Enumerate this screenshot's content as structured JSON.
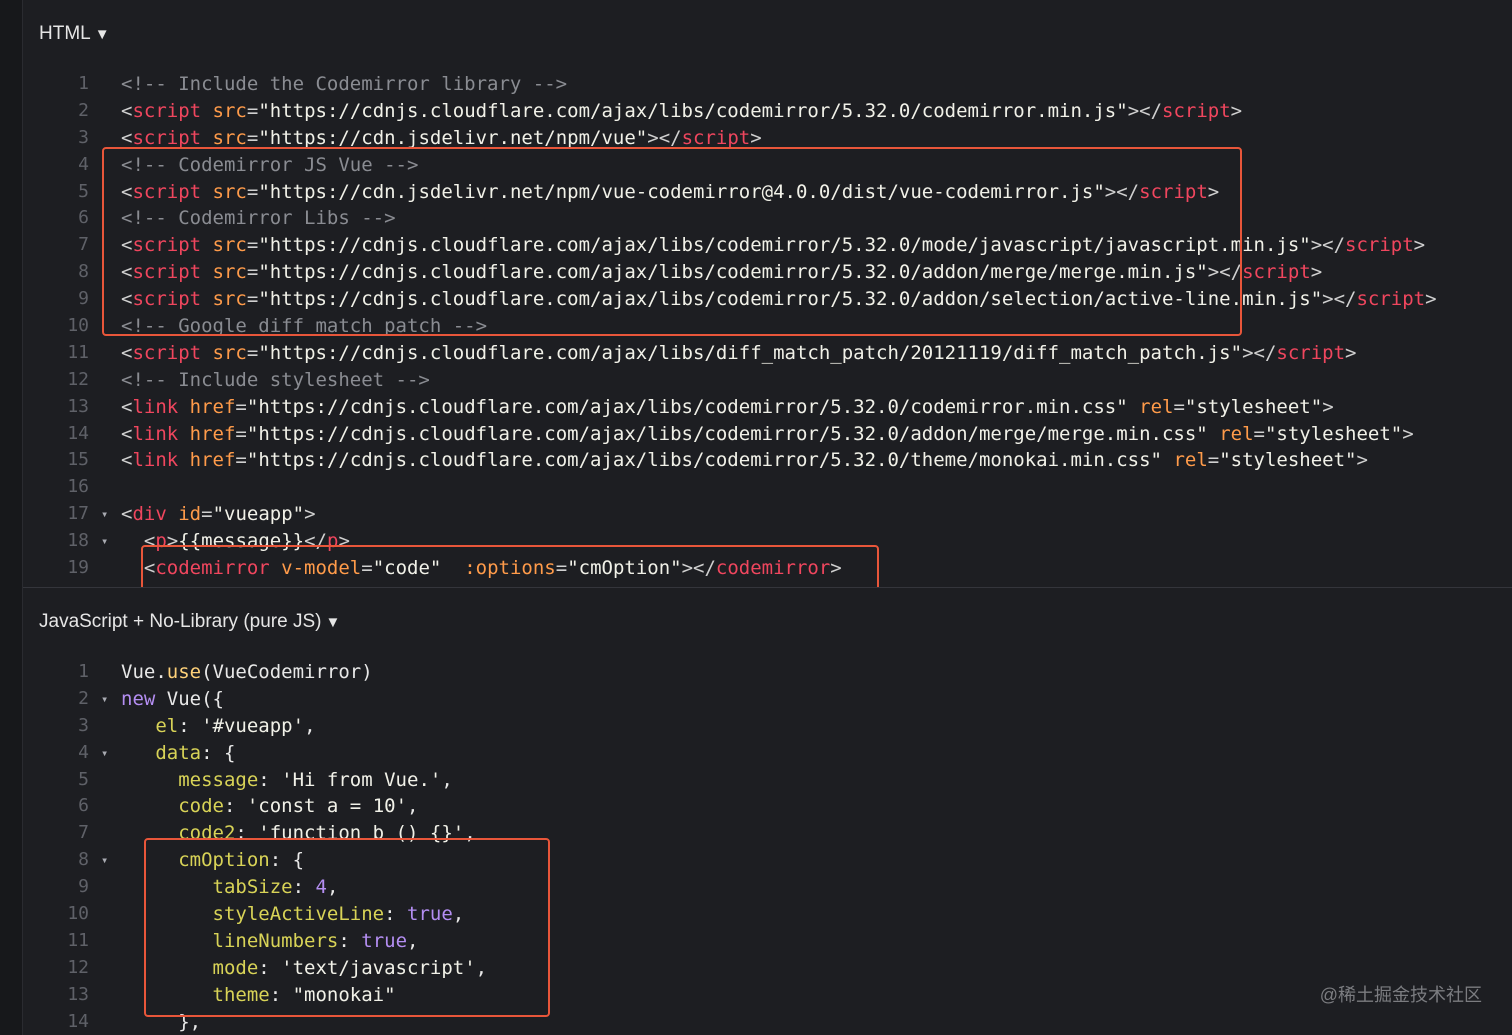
{
  "html_pane": {
    "header": "HTML",
    "lines": [
      {
        "n": "1",
        "fold": "",
        "t": [
          [
            "comment",
            "<!-- Include the Codemirror library -->"
          ]
        ]
      },
      {
        "n": "2",
        "fold": "",
        "t": [
          [
            "punct",
            "<"
          ],
          [
            "tag",
            "script"
          ],
          [
            "attr",
            " src"
          ],
          [
            "punct",
            "="
          ],
          [
            "str",
            "\"https://cdnjs.cloudflare.com/ajax/libs/codemirror/5.32.0/codemirror.min.js\""
          ],
          [
            "punct",
            "></"
          ],
          [
            "tag",
            "script"
          ],
          [
            "punct",
            ">"
          ]
        ]
      },
      {
        "n": "3",
        "fold": "",
        "t": [
          [
            "punct",
            "<"
          ],
          [
            "tag",
            "script"
          ],
          [
            "attr",
            " src"
          ],
          [
            "punct",
            "="
          ],
          [
            "str",
            "\"https://cdn.jsdelivr.net/npm/vue\""
          ],
          [
            "punct",
            "></"
          ],
          [
            "tag",
            "script"
          ],
          [
            "punct",
            ">"
          ]
        ]
      },
      {
        "n": "4",
        "fold": "",
        "t": [
          [
            "comment",
            "<!-- Codemirror JS Vue -->"
          ]
        ]
      },
      {
        "n": "5",
        "fold": "",
        "t": [
          [
            "punct",
            "<"
          ],
          [
            "tag",
            "script"
          ],
          [
            "attr",
            " src"
          ],
          [
            "punct",
            "="
          ],
          [
            "str",
            "\"https://cdn.jsdelivr.net/npm/vue-codemirror@4.0.0/dist/vue-codemirror.js\""
          ],
          [
            "punct",
            "></"
          ],
          [
            "tag",
            "script"
          ],
          [
            "punct",
            ">"
          ]
        ]
      },
      {
        "n": "6",
        "fold": "",
        "t": [
          [
            "comment",
            "<!-- Codemirror Libs -->"
          ]
        ]
      },
      {
        "n": "7",
        "fold": "",
        "t": [
          [
            "punct",
            "<"
          ],
          [
            "tag",
            "script"
          ],
          [
            "attr",
            " src"
          ],
          [
            "punct",
            "="
          ],
          [
            "str",
            "\"https://cdnjs.cloudflare.com/ajax/libs/codemirror/5.32.0/mode/javascript/javascript.min.js\""
          ],
          [
            "punct",
            "></"
          ],
          [
            "tag",
            "script"
          ],
          [
            "punct",
            ">"
          ]
        ]
      },
      {
        "n": "8",
        "fold": "",
        "t": [
          [
            "punct",
            "<"
          ],
          [
            "tag",
            "script"
          ],
          [
            "attr",
            " src"
          ],
          [
            "punct",
            "="
          ],
          [
            "str",
            "\"https://cdnjs.cloudflare.com/ajax/libs/codemirror/5.32.0/addon/merge/merge.min.js\""
          ],
          [
            "punct",
            "></"
          ],
          [
            "tag",
            "script"
          ],
          [
            "punct",
            ">"
          ]
        ]
      },
      {
        "n": "9",
        "fold": "",
        "t": [
          [
            "punct",
            "<"
          ],
          [
            "tag",
            "script"
          ],
          [
            "attr",
            " src"
          ],
          [
            "punct",
            "="
          ],
          [
            "str",
            "\"https://cdnjs.cloudflare.com/ajax/libs/codemirror/5.32.0/addon/selection/active-line.min.js\""
          ],
          [
            "punct",
            "></"
          ],
          [
            "tag",
            "script"
          ],
          [
            "punct",
            ">"
          ]
        ]
      },
      {
        "n": "10",
        "fold": "",
        "t": [
          [
            "comment",
            "<!-- Google diff match patch -->"
          ]
        ]
      },
      {
        "n": "11",
        "fold": "",
        "t": [
          [
            "punct",
            "<"
          ],
          [
            "tag",
            "script"
          ],
          [
            "attr",
            " src"
          ],
          [
            "punct",
            "="
          ],
          [
            "str",
            "\"https://cdnjs.cloudflare.com/ajax/libs/diff_match_patch/20121119/diff_match_patch.js\""
          ],
          [
            "punct",
            "></"
          ],
          [
            "tag",
            "script"
          ],
          [
            "punct",
            ">"
          ]
        ]
      },
      {
        "n": "12",
        "fold": "",
        "t": [
          [
            "comment",
            "<!-- Include stylesheet -->"
          ]
        ]
      },
      {
        "n": "13",
        "fold": "",
        "t": [
          [
            "punct",
            "<"
          ],
          [
            "tag",
            "link"
          ],
          [
            "attr",
            " href"
          ],
          [
            "punct",
            "="
          ],
          [
            "str",
            "\"https://cdnjs.cloudflare.com/ajax/libs/codemirror/5.32.0/codemirror.min.css\""
          ],
          [
            "attr",
            " rel"
          ],
          [
            "punct",
            "="
          ],
          [
            "str",
            "\"stylesheet\""
          ],
          [
            "punct",
            ">"
          ]
        ]
      },
      {
        "n": "14",
        "fold": "",
        "t": [
          [
            "punct",
            "<"
          ],
          [
            "tag",
            "link"
          ],
          [
            "attr",
            " href"
          ],
          [
            "punct",
            "="
          ],
          [
            "str",
            "\"https://cdnjs.cloudflare.com/ajax/libs/codemirror/5.32.0/addon/merge/merge.min.css\""
          ],
          [
            "attr",
            " rel"
          ],
          [
            "punct",
            "="
          ],
          [
            "str",
            "\"stylesheet\""
          ],
          [
            "punct",
            ">"
          ]
        ]
      },
      {
        "n": "15",
        "fold": "",
        "t": [
          [
            "punct",
            "<"
          ],
          [
            "tag",
            "link"
          ],
          [
            "attr",
            " href"
          ],
          [
            "punct",
            "="
          ],
          [
            "str",
            "\"https://cdnjs.cloudflare.com/ajax/libs/codemirror/5.32.0/theme/monokai.min.css\""
          ],
          [
            "attr",
            " rel"
          ],
          [
            "punct",
            "="
          ],
          [
            "str",
            "\"stylesheet\""
          ],
          [
            "punct",
            ">"
          ]
        ]
      },
      {
        "n": "16",
        "fold": "",
        "t": []
      },
      {
        "n": "17",
        "fold": "▾",
        "t": [
          [
            "punct",
            "<"
          ],
          [
            "tag",
            "div"
          ],
          [
            "attr",
            " id"
          ],
          [
            "punct",
            "="
          ],
          [
            "str",
            "\"vueapp\""
          ],
          [
            "punct",
            ">"
          ]
        ]
      },
      {
        "n": "18",
        "fold": "▾",
        "t": [
          [
            "plain",
            "  "
          ],
          [
            "punct",
            "<"
          ],
          [
            "tag",
            "p"
          ],
          [
            "punct",
            ">"
          ],
          [
            "str",
            "{{message}}"
          ],
          [
            "punct",
            "</"
          ],
          [
            "tag",
            "p"
          ],
          [
            "punct",
            ">"
          ]
        ]
      },
      {
        "n": "19",
        "fold": "",
        "t": [
          [
            "plain",
            "  "
          ],
          [
            "punct",
            "<"
          ],
          [
            "tag",
            "codemirror"
          ],
          [
            "attr",
            " v-model"
          ],
          [
            "punct",
            "="
          ],
          [
            "str",
            "\"code\""
          ],
          [
            "attr",
            "  :options"
          ],
          [
            "punct",
            "="
          ],
          [
            "str",
            "\"cmOption\""
          ],
          [
            "punct",
            "></"
          ],
          [
            "tag",
            "codemirror"
          ],
          [
            "punct",
            ">"
          ]
        ]
      }
    ]
  },
  "js_pane": {
    "header": "JavaScript + No-Library (pure JS)",
    "lines": [
      {
        "n": "1",
        "fold": "",
        "t": [
          [
            "plain",
            "Vue."
          ],
          [
            "fn",
            "use"
          ],
          [
            "plain",
            "(VueCodemirror)"
          ]
        ]
      },
      {
        "n": "2",
        "fold": "▾",
        "t": [
          [
            "kw",
            "new "
          ],
          [
            "plain",
            "Vue({"
          ]
        ]
      },
      {
        "n": "3",
        "fold": "",
        "t": [
          [
            "plain",
            "   "
          ],
          [
            "prop",
            "el"
          ],
          [
            "plain",
            ": "
          ],
          [
            "str",
            "'#vueapp'"
          ],
          [
            "plain",
            ","
          ]
        ]
      },
      {
        "n": "4",
        "fold": "▾",
        "t": [
          [
            "plain",
            "   "
          ],
          [
            "prop",
            "data"
          ],
          [
            "plain",
            ": {"
          ]
        ]
      },
      {
        "n": "5",
        "fold": "",
        "t": [
          [
            "plain",
            "     "
          ],
          [
            "prop",
            "message"
          ],
          [
            "plain",
            ": "
          ],
          [
            "str",
            "'Hi from Vue.'"
          ],
          [
            "plain",
            ","
          ]
        ]
      },
      {
        "n": "6",
        "fold": "",
        "t": [
          [
            "plain",
            "     "
          ],
          [
            "prop",
            "code"
          ],
          [
            "plain",
            ": "
          ],
          [
            "str",
            "'const a = 10'"
          ],
          [
            "plain",
            ","
          ]
        ]
      },
      {
        "n": "7",
        "fold": "",
        "t": [
          [
            "plain",
            "     "
          ],
          [
            "prop",
            "code2"
          ],
          [
            "plain",
            ": "
          ],
          [
            "str",
            "'function b () {}'"
          ],
          [
            "plain",
            ","
          ]
        ]
      },
      {
        "n": "8",
        "fold": "▾",
        "t": [
          [
            "plain",
            "     "
          ],
          [
            "prop",
            "cmOption"
          ],
          [
            "plain",
            ": {"
          ]
        ]
      },
      {
        "n": "9",
        "fold": "",
        "t": [
          [
            "plain",
            "        "
          ],
          [
            "prop",
            "tabSize"
          ],
          [
            "plain",
            ": "
          ],
          [
            "num",
            "4"
          ],
          [
            "plain",
            ","
          ]
        ]
      },
      {
        "n": "10",
        "fold": "",
        "t": [
          [
            "plain",
            "        "
          ],
          [
            "prop",
            "styleActiveLine"
          ],
          [
            "plain",
            ": "
          ],
          [
            "kw",
            "true"
          ],
          [
            "plain",
            ","
          ]
        ]
      },
      {
        "n": "11",
        "fold": "",
        "t": [
          [
            "plain",
            "        "
          ],
          [
            "prop",
            "lineNumbers"
          ],
          [
            "plain",
            ": "
          ],
          [
            "kw",
            "true"
          ],
          [
            "plain",
            ","
          ]
        ]
      },
      {
        "n": "12",
        "fold": "",
        "t": [
          [
            "plain",
            "        "
          ],
          [
            "prop",
            "mode"
          ],
          [
            "plain",
            ": "
          ],
          [
            "str",
            "'text/javascript'"
          ],
          [
            "plain",
            ","
          ]
        ]
      },
      {
        "n": "13",
        "fold": "",
        "t": [
          [
            "plain",
            "        "
          ],
          [
            "prop",
            "theme"
          ],
          [
            "plain",
            ": "
          ],
          [
            "str",
            "\"monokai\""
          ]
        ]
      },
      {
        "n": "14",
        "fold": "",
        "t": [
          [
            "plain",
            "     },"
          ]
        ]
      }
    ]
  },
  "watermark": "@稀土掘金技术社区",
  "colors": {
    "highlight_border": "#e8563a",
    "background": "#1d1e22"
  }
}
